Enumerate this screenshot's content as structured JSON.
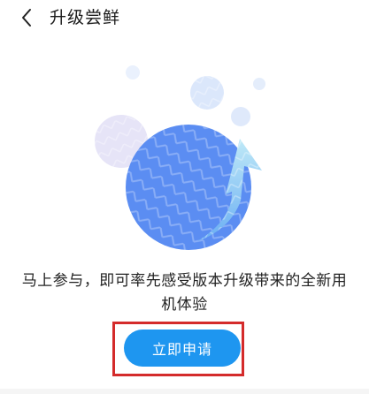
{
  "header": {
    "back_icon": "chevron-left-icon",
    "title": "升级尝鲜"
  },
  "illustration": {
    "description_icon": "upgrade-arrow-circle-icon",
    "colors": {
      "main_circle": "#5b8df2",
      "arrow": "#8fd3f4",
      "bubble": "#dfe9fb",
      "bubble_lilac": "#e6e4f7"
    }
  },
  "content": {
    "intro_text": "马上参与，即可率先感受版本升级带来的全新用机体验"
  },
  "actions": {
    "apply_label": "立即申请",
    "apply_color": "#1e96f0",
    "highlight_color": "#d42b2b"
  }
}
